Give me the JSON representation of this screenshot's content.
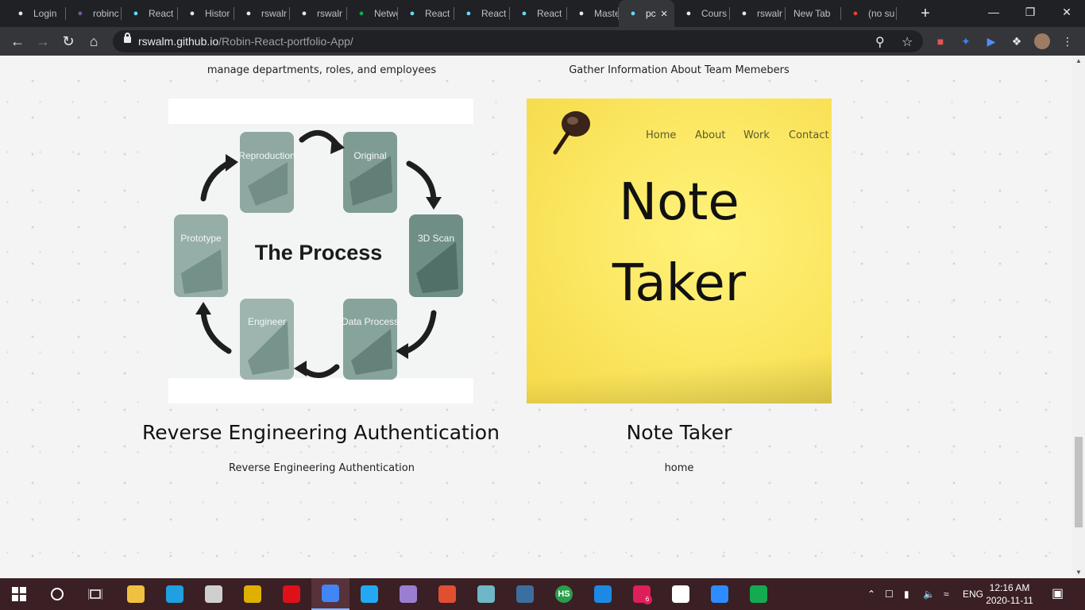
{
  "browser": {
    "tabs": [
      {
        "title": "Login",
        "icon": "globe-icon",
        "color": "#e8eaed"
      },
      {
        "title": "robinc",
        "icon": "heroku-icon",
        "color": "#79589f"
      },
      {
        "title": "React",
        "icon": "react-icon",
        "color": "#61dafb"
      },
      {
        "title": "Histor",
        "icon": "google-icon",
        "color": "#e8eaed"
      },
      {
        "title": "rswalr",
        "icon": "github-icon",
        "color": "#e8eaed"
      },
      {
        "title": "rswalr",
        "icon": "github-icon",
        "color": "#e8eaed"
      },
      {
        "title": "Netwo",
        "icon": "mongodb-leaf-icon",
        "color": "#13aa52"
      },
      {
        "title": "React",
        "icon": "react-icon",
        "color": "#61dafb"
      },
      {
        "title": "React",
        "icon": "react-icon",
        "color": "#61dafb"
      },
      {
        "title": "React",
        "icon": "react-icon",
        "color": "#61dafb"
      },
      {
        "title": "Maste",
        "icon": "github-icon",
        "color": "#e8eaed"
      },
      {
        "title": "pc",
        "icon": "react-icon",
        "color": "#61dafb",
        "active": true
      },
      {
        "title": "Cours",
        "icon": "globe-icon",
        "color": "#e8eaed"
      },
      {
        "title": "rswalr",
        "icon": "github-icon",
        "color": "#e8eaed"
      },
      {
        "title": "New Tab",
        "icon": "",
        "color": "#e8eaed"
      },
      {
        "title": "(no su",
        "icon": "gmail-icon",
        "color": "#ea4335"
      }
    ],
    "new_tab_label": "+",
    "window_controls": {
      "minimize": "—",
      "restore": "❐",
      "close": "✕"
    },
    "url_host": "rswalm.github.io",
    "url_path": "/Robin-React-portfolio-App/"
  },
  "page": {
    "top_left_desc": "manage departments, roles, and employees",
    "top_right_desc": "Gather Information About Team Memebers",
    "project_left": {
      "image_title": "The Process",
      "cycle_steps": [
        "Reproduction",
        "Original",
        "3D Scan",
        "Data Process",
        "Engineer",
        "Prototype"
      ],
      "title": "Reverse Engineering Authentication",
      "desc": "Reverse Engineering Authentication"
    },
    "project_right": {
      "nav": [
        "Home",
        "About",
        "Work",
        "Contact"
      ],
      "image_line1": "Note",
      "image_line2": "Taker",
      "title": "Note Taker",
      "desc": "home"
    }
  },
  "taskbar": {
    "apps": [
      {
        "name": "file-explorer-icon",
        "color": "#f0c040"
      },
      {
        "name": "edge-icon",
        "color": "#1fa0e0"
      },
      {
        "name": "notepad-icon",
        "color": "#cfcfcf"
      },
      {
        "name": "paint-icon",
        "color": "#e0b000"
      },
      {
        "name": "opera-icon",
        "color": "#e0101b"
      },
      {
        "name": "chrome-icon",
        "color": "#4285f4",
        "active": true
      },
      {
        "name": "vscode-icon",
        "color": "#23a9f2"
      },
      {
        "name": "paint3d-icon",
        "color": "#9a7fd0"
      },
      {
        "name": "gitkraken-icon",
        "color": "#e05030"
      },
      {
        "name": "editor-icon",
        "color": "#6fb7c7"
      },
      {
        "name": "mysql-workbench-icon",
        "color": "#3b6fa0"
      },
      {
        "name": "hs-icon",
        "color": "#2a9d4a",
        "label": "HS"
      },
      {
        "name": "media-player-icon",
        "color": "#1e88e5"
      },
      {
        "name": "slack-icon",
        "color": "#e01e5a",
        "badge": "6"
      },
      {
        "name": "settings-icon",
        "color": "#ffffff"
      },
      {
        "name": "zoom-icon",
        "color": "#2d8cff"
      },
      {
        "name": "mongodb-compass-icon",
        "color": "#13aa52"
      }
    ],
    "language": "ENG",
    "time": "12:16 AM",
    "date": "2020-11-11"
  }
}
